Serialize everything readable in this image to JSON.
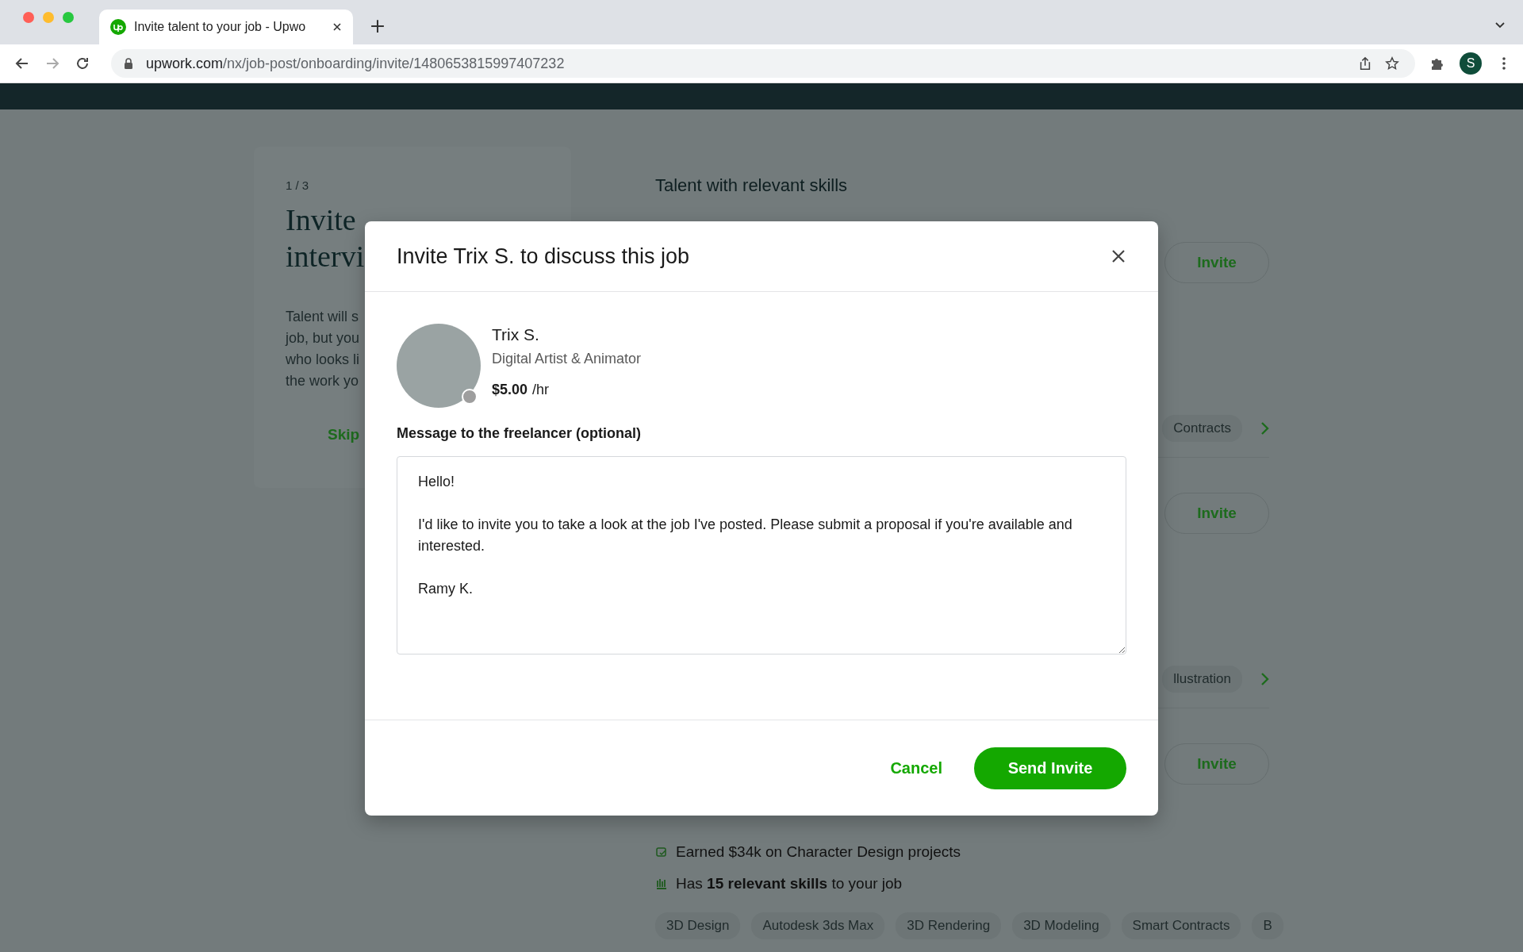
{
  "browser": {
    "tab_title": "Invite talent to your job - Upwo",
    "url_domain": "upwork.com",
    "url_path": "/nx/job-post/onboarding/invite/1480653815997407232",
    "profile_initial": "S"
  },
  "onboarding": {
    "step": "1 / 3",
    "title_lines": [
      "Invite",
      "intervi"
    ],
    "text_lines": [
      "Talent will s",
      "job, but you",
      "who looks li",
      "the work yo"
    ],
    "skip": "Skip"
  },
  "talent": {
    "heading": "Talent with relevant skills",
    "rows": [
      {
        "invite": "Invite",
        "chips": [
          "Contracts"
        ]
      },
      {
        "invite": "Invite",
        "chips": [
          "llustration"
        ]
      },
      {
        "invite": "Invite",
        "earned": "Earned $34k on Character Design projects",
        "skills": "Has **15 relevant skills** to your job",
        "chips": [
          "3D Design",
          "Autodesk 3ds Max",
          "3D Rendering",
          "3D Modeling",
          "Smart Contracts",
          "B"
        ]
      }
    ]
  },
  "modal": {
    "title": "Invite Trix S. to discuss this job",
    "freelancer": {
      "name": "Trix S.",
      "role": "Digital Artist & Animator",
      "rate": "$5.00",
      "rate_unit": "/hr",
      "online": false
    },
    "message_label": "Message to the freelancer (optional)",
    "message": "Hello!\n\nI'd like to invite you to take a look at the job I've posted. Please submit a proposal if you're available and interested.\n\nRamy K.",
    "cancel": "Cancel",
    "send": "Send Invite"
  }
}
